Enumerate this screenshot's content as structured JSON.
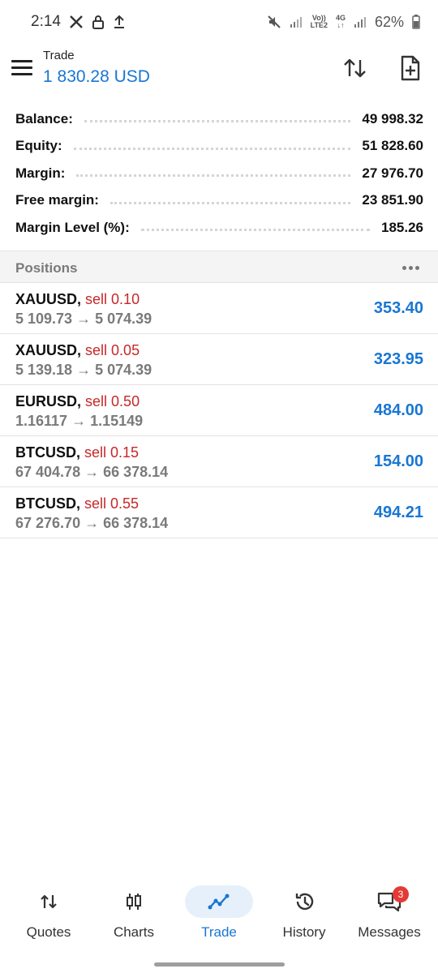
{
  "statusbar": {
    "time": "2:14",
    "network_top": "Vo))",
    "network_bottom": "LTE2",
    "net_type": "4G",
    "battery": "62%"
  },
  "appbar": {
    "title": "Trade",
    "subtitle": "1 830.28 USD"
  },
  "summary": [
    {
      "label": "Balance:",
      "value": "49 998.32"
    },
    {
      "label": "Equity:",
      "value": "51 828.60"
    },
    {
      "label": "Margin:",
      "value": "27 976.70"
    },
    {
      "label": "Free margin:",
      "value": "23 851.90"
    },
    {
      "label": "Margin Level (%):",
      "value": "185.26"
    }
  ],
  "positions_header": "Positions",
  "positions": [
    {
      "symbol": "XAUUSD",
      "side": "sell 0.10",
      "prices": "5 109.73 → 5 074.39",
      "profit": "353.40"
    },
    {
      "symbol": "XAUUSD",
      "side": "sell 0.05",
      "prices": "5 139.18 → 5 074.39",
      "profit": "323.95"
    },
    {
      "symbol": "EURUSD",
      "side": "sell 0.50",
      "prices": "1.16117 → 1.15149",
      "profit": "484.00"
    },
    {
      "symbol": "BTCUSD",
      "side": "sell 0.15",
      "prices": "67 404.78 → 66 378.14",
      "profit": "154.00"
    },
    {
      "symbol": "BTCUSD",
      "side": "sell 0.55",
      "prices": "67 276.70 → 66 378.14",
      "profit": "494.21"
    }
  ],
  "nav": [
    {
      "label": "Quotes",
      "icon": "quotes-icon"
    },
    {
      "label": "Charts",
      "icon": "charts-icon"
    },
    {
      "label": "Trade",
      "icon": "trade-icon",
      "active": true
    },
    {
      "label": "History",
      "icon": "history-icon"
    },
    {
      "label": "Messages",
      "icon": "messages-icon",
      "badge": "3"
    }
  ],
  "colors": {
    "accent": "#1976d2",
    "sell": "#c62828",
    "badge": "#e53935"
  }
}
